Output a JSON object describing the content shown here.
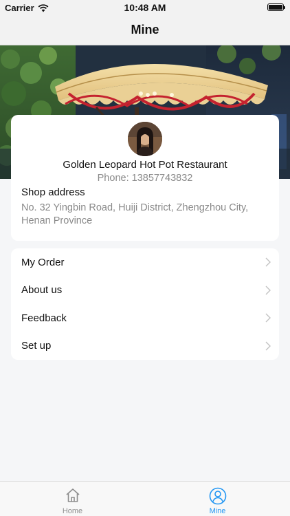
{
  "status_bar": {
    "carrier": "Carrier",
    "time": "10:48 AM"
  },
  "nav": {
    "title": "Mine"
  },
  "shop": {
    "name": "Golden Leopard Hot Pot Restaurant",
    "phone": "Phone: 13857743832",
    "address_label": "Shop address",
    "address": "No. 32 Yingbin Road, Huiji District, Zhengzhou City, Henan Province"
  },
  "menu": {
    "items": [
      {
        "label": "My Order"
      },
      {
        "label": "About us"
      },
      {
        "label": "Feedback"
      },
      {
        "label": "Set up"
      }
    ]
  },
  "tabbar": {
    "home_label": "Home",
    "mine_label": "Mine",
    "active_color": "#2196f3",
    "inactive_color": "#8e8e8e"
  }
}
